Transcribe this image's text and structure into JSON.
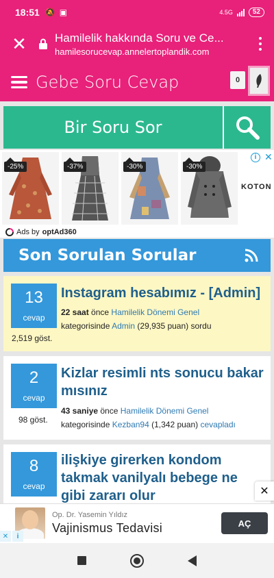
{
  "status": {
    "time": "18:51",
    "network": "4.5G",
    "battery": "52"
  },
  "browser": {
    "page_title": "Hamilelik hakkında Soru ve Ce...",
    "domain": "hamilesorucevap.annelertoplandik.com"
  },
  "site": {
    "title": "Gebe Soru Cevap",
    "notification_count": "0"
  },
  "ask": {
    "label": "Bir Soru Sor"
  },
  "ad_banner": {
    "brand": "KOTON",
    "ads_by_prefix": "Ads by",
    "ads_by_name": "optAd360",
    "products": [
      {
        "discount": "-25%"
      },
      {
        "discount": "-37%"
      },
      {
        "discount": "-30%"
      },
      {
        "discount": "-30%"
      }
    ]
  },
  "section": {
    "title": "Son Sorulan Sorular"
  },
  "questions": [
    {
      "answers": "13",
      "answers_label": "cevap",
      "views": "2,519 göst.",
      "title": "Instagram hesabımız - [Admin]",
      "time": "22 saat",
      "time_suffix": " önce ",
      "category": "Hamilelik Dönemi Genel",
      "category_suffix": " kategorisinde ",
      "user": "Admin",
      "points": " (29,935 puan) ",
      "action": "sordu"
    },
    {
      "answers": "2",
      "answers_label": "cevap",
      "views": "98 göst.",
      "title": "Kizlar resimli nts sonucu bakar mısınız",
      "time": "43 saniye",
      "time_suffix": " önce ",
      "category": "Hamilelik Dönemi Genel",
      "category_suffix": "kategorisinde ",
      "user": "Kezban94",
      "points": " (1,342 puan) ",
      "action": "cevapladı"
    },
    {
      "answers": "8",
      "answers_label": "cevap",
      "title": "ilişkiye girerken kondom takmak vanilyalı bebege ne gibi zararı olur"
    }
  ],
  "bottom_ad": {
    "subtitle": "Op. Dr. Yasemin Yıldız",
    "title": "Vajinismus Tedavisi",
    "button": "AÇ"
  },
  "colors": {
    "brand_pink": "#e8217a",
    "ask_green": "#2cb88f",
    "section_blue": "#3498db",
    "highlight": "#fdf7c4"
  }
}
